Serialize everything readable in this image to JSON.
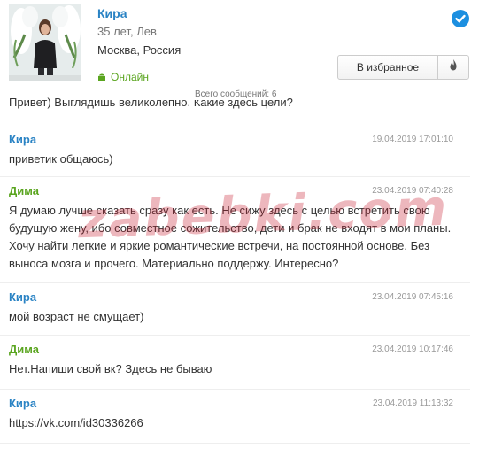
{
  "profile": {
    "name": "Кира",
    "age_sign": "35 лет, Лев",
    "city": "Москва, Россия",
    "status": "Онлайн",
    "status_icon": "android-icon",
    "verified_icon": "verified-check-icon",
    "favorites_button": "В избранное",
    "fire_icon": "fire-icon",
    "total_messages": "Всего сообщений: 6"
  },
  "partial_message": "Привет) Выглядишь великолепно. Какие здесь цели?",
  "messages": [
    {
      "author": "Кира",
      "time": "19.04.2019 17:01:10",
      "text": "приветик общаюсь)"
    },
    {
      "author": "Дима",
      "time": "23.04.2019 07:40:28",
      "text": "Я думаю лучше сказать сразу как есть. Не сижу здесь с целью встретить свою будущую жену, ибо совместное сожительство, дети и брак не входят в мои планы. Хочу найти легкие и яркие романтические встречи, на постоянной основе. Без выноса мозга и прочего. Материально поддержу. Интересно?"
    },
    {
      "author": "Кира",
      "time": "23.04.2019 07:45:16",
      "text": "мой возраст не смущает)"
    },
    {
      "author": "Дима",
      "time": "23.04.2019 10:17:46",
      "text": "Нет.Напиши свой вк? Здесь не бываю"
    },
    {
      "author": "Кира",
      "time": "23.04.2019 11:13:32",
      "text": "https://vk.com/id30336266"
    }
  ],
  "watermark": "zabebki.com",
  "colors": {
    "kira": "#2a83c4",
    "dima": "#5aa51f",
    "verified": "#1c8fe0",
    "watermark": "#c81e32"
  }
}
